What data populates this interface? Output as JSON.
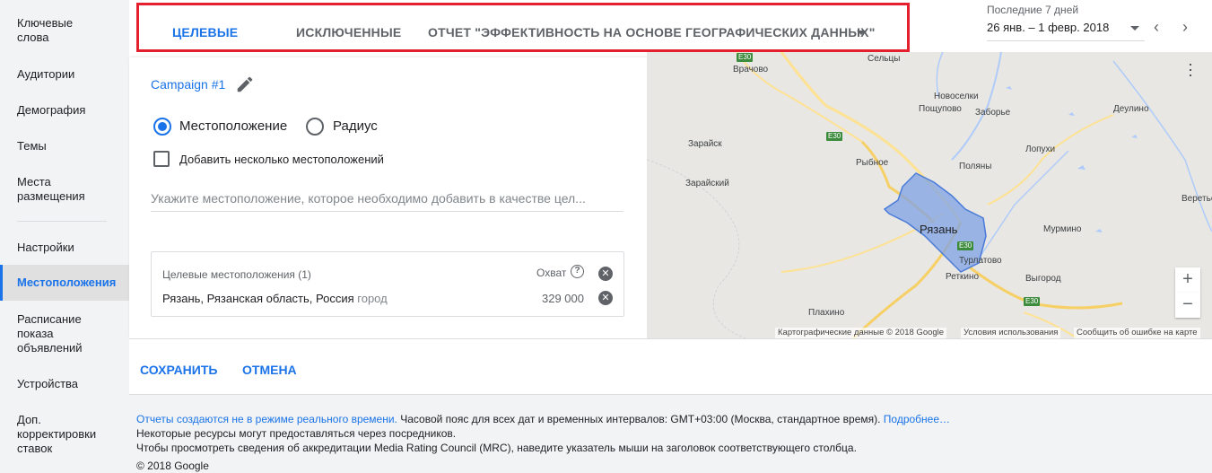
{
  "sidebar": {
    "items": [
      {
        "label": "Ключевые\nслова"
      },
      {
        "label": "Аудитории"
      },
      {
        "label": "Демография"
      },
      {
        "label": "Темы"
      },
      {
        "label": "Места\nразмещения"
      },
      {
        "label": "Настройки"
      },
      {
        "label": "Местоположения"
      },
      {
        "label": "Расписание\nпоказа\nобъявлений"
      },
      {
        "label": "Устройства"
      },
      {
        "label": "Доп.\nкорректировки\nставок"
      }
    ]
  },
  "tabs": {
    "items": [
      {
        "label": "ЦЕЛЕВЫЕ"
      },
      {
        "label": "ИСКЛЮЧЕННЫЕ"
      },
      {
        "label": "ОТЧЕТ \"ЭФФЕКТИВНОСТЬ НА ОСНОВЕ ГЕОГРАФИЧЕСКИХ ДАННЫХ\""
      }
    ]
  },
  "date_range": {
    "label": "Последние 7 дней",
    "value": "26 янв. – 1 февр. 2018"
  },
  "panel": {
    "campaign": "Campaign #1",
    "radio_location": "Местоположение",
    "radio_radius": "Радиус",
    "checkbox_multi": "Добавить несколько местоположений",
    "input_placeholder": "Укажите местоположение, которое необходимо добавить в качестве цел...",
    "targets": {
      "header": "Целевые местоположения (1)",
      "reach_label": "Охват",
      "row_name": "Рязань, Рязанская область, Россия",
      "row_type": "город",
      "row_reach": "329 000"
    }
  },
  "map": {
    "cities": [
      "Сельцы",
      "Врачово",
      "Новоселки",
      "Пощупово",
      "Заборье",
      "Деулино",
      "Зарайск",
      "Лопухи",
      "Рыбное",
      "Поляны",
      "Зарайский",
      "Веретье",
      "Рязань",
      "Мурмино",
      "Турлатово",
      "Реткино",
      "Выгород",
      "Плахино"
    ],
    "road_labels": [
      "E30",
      "E30",
      "E30",
      "E30"
    ],
    "attribution": "Картографические данные © 2018 Google",
    "terms": "Условия использования",
    "report": "Сообщить об ошибке на карте",
    "zoom_in": "+",
    "zoom_out": "−"
  },
  "actions": {
    "save": "СОХРАНИТЬ",
    "cancel": "ОТМЕНА"
  },
  "footer": {
    "link1": "Отчеты создаются не в режиме реального времени.",
    "text1": " Часовой пояс для всех дат и временных интервалов: GMT+03:00 (Москва, стандартное время). ",
    "link2": "Подробнее…",
    "line2": "Некоторые ресурсы могут предоставляться через посредников.",
    "line3": "Чтобы просмотреть сведения об аккредитации Media Rating Council (MRC), наведите указатель мыши на заголовок соответствующего столбца.",
    "copyright": "© 2018 Google"
  },
  "colors": {
    "accent": "#1a73e8",
    "highlight_border": "#e5202e",
    "city_polygon": "#7ea2e6"
  }
}
